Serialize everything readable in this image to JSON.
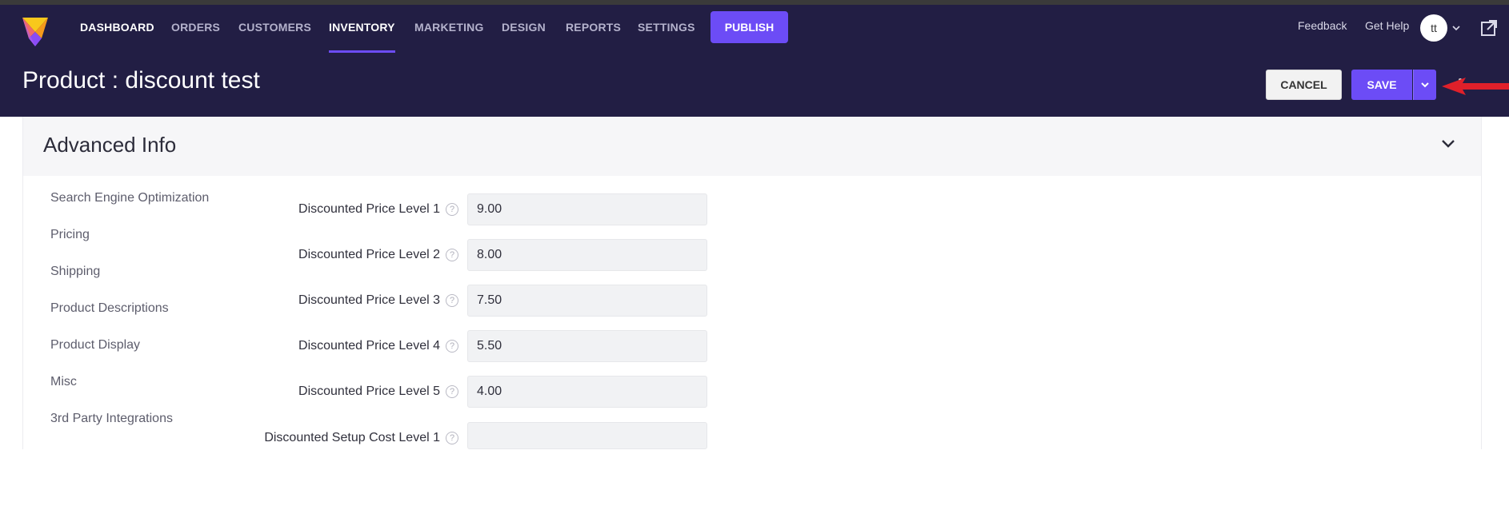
{
  "nav": {
    "items": [
      {
        "label": "DASHBOARD"
      },
      {
        "label": "ORDERS"
      },
      {
        "label": "CUSTOMERS"
      },
      {
        "label": "INVENTORY"
      },
      {
        "label": "MARKETING"
      },
      {
        "label": "DESIGN"
      },
      {
        "label": "REPORTS"
      },
      {
        "label": "SETTINGS"
      }
    ],
    "active": "INVENTORY",
    "publish_label": "PUBLISH"
  },
  "header": {
    "feedback_label": "Feedback",
    "help_label": "Get Help",
    "avatar_initials": "tt",
    "page_title": "Product : discount test",
    "cancel_label": "CANCEL",
    "save_label": "SAVE"
  },
  "panel": {
    "title": "Advanced Info",
    "sidebar": [
      {
        "label": "Search Engine Optimization"
      },
      {
        "label": "Pricing"
      },
      {
        "label": "Shipping"
      },
      {
        "label": "Product Descriptions"
      },
      {
        "label": "Product Display"
      },
      {
        "label": "Misc"
      },
      {
        "label": "3rd Party Integrations"
      }
    ],
    "fields": [
      {
        "label": "Discounted Price Level 1",
        "value": "9.00"
      },
      {
        "label": "Discounted Price Level 2",
        "value": "8.00"
      },
      {
        "label": "Discounted Price Level 3",
        "value": "7.50"
      },
      {
        "label": "Discounted Price Level 4",
        "value": "5.50"
      },
      {
        "label": "Discounted Price Level 5",
        "value": "4.00"
      },
      {
        "label": "Discounted Setup Cost Level 1",
        "value": ""
      }
    ]
  },
  "colors": {
    "header_bg": "#221e44",
    "accent": "#6c4cf6",
    "annotation_arrow": "#e0202a"
  },
  "icons": [
    "logo-icon",
    "chevron-down-icon",
    "external-link-icon",
    "help-circle-icon",
    "red-arrow-icon"
  ]
}
